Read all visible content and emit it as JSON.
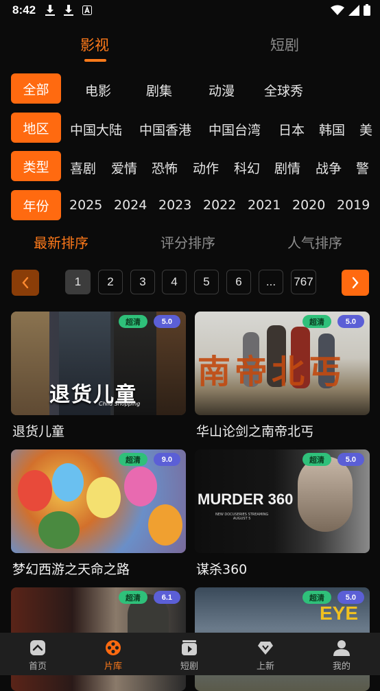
{
  "status_bar": {
    "time": "8:42"
  },
  "top_tabs": [
    {
      "label": "影视",
      "active": true
    },
    {
      "label": "短剧",
      "active": false
    }
  ],
  "filters": {
    "category": {
      "options": [
        "全部",
        "电影",
        "剧集",
        "动漫",
        "全球秀"
      ]
    },
    "region": {
      "label": "地区",
      "options": [
        "中国大陆",
        "中国香港",
        "中国台湾",
        "日本",
        "韩国",
        "美"
      ]
    },
    "genre": {
      "label": "类型",
      "options": [
        "喜剧",
        "爱情",
        "恐怖",
        "动作",
        "科幻",
        "剧情",
        "战争",
        "警"
      ]
    },
    "year": {
      "label": "年份",
      "options": [
        "2025",
        "2024",
        "2023",
        "2022",
        "2021",
        "2020",
        "2019"
      ]
    }
  },
  "sort_tabs": [
    {
      "label": "最新排序",
      "active": true
    },
    {
      "label": "评分排序",
      "active": false
    },
    {
      "label": "人气排序",
      "active": false
    }
  ],
  "pagination": {
    "pages": [
      "1",
      "2",
      "3",
      "4",
      "5",
      "6",
      "...",
      "767"
    ],
    "current": "1"
  },
  "cards": [
    {
      "title": "退货儿童",
      "quality": "超清",
      "score": "5.0",
      "poster_text": "退货儿童",
      "poster_sub": "Child Shopping"
    },
    {
      "title": "华山论剑之南帝北丐",
      "quality": "超清",
      "score": "5.0",
      "poster_text": "南帝北丐",
      "poster_sub": ""
    },
    {
      "title": "梦幻西游之天命之路",
      "quality": "超清",
      "score": "9.0",
      "poster_text": "",
      "poster_sub": ""
    },
    {
      "title": "谋杀360",
      "quality": "超清",
      "score": "5.0",
      "poster_text": "MURDER 360",
      "poster_sub": "NEW DOCUSERIES STREAMING\nAUGUST 5"
    },
    {
      "title": "",
      "quality": "超清",
      "score": "6.1",
      "poster_text": "",
      "poster_sub": ""
    },
    {
      "title": "",
      "quality": "超清",
      "score": "5.0",
      "poster_text": "EYE",
      "poster_sub": ""
    }
  ],
  "bottom_nav": [
    {
      "label": "首页",
      "icon": "home-icon",
      "active": false
    },
    {
      "label": "片库",
      "icon": "film-reel-icon",
      "active": true
    },
    {
      "label": "短剧",
      "icon": "play-clip-icon",
      "active": false
    },
    {
      "label": "上新",
      "icon": "diamond-icon",
      "active": false
    },
    {
      "label": "我的",
      "icon": "user-icon",
      "active": false
    }
  ],
  "colors": {
    "accent": "#ff6a10",
    "background": "#0b0b0b",
    "quality_badge": "#2fc07a",
    "score_badge": "#5b5fd6"
  }
}
